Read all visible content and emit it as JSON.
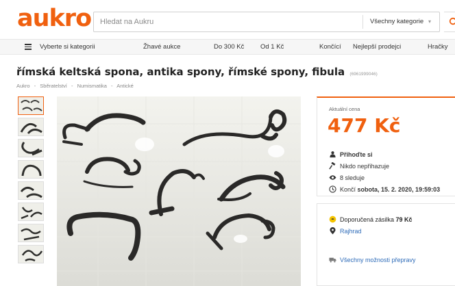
{
  "brand": {
    "logo": "aukro"
  },
  "search": {
    "placeholder": "Hledat na Aukru",
    "category": "Všechny kategorie"
  },
  "nav": {
    "all_categories": "Vyberte si kategorii",
    "items": [
      "Žhavé aukce",
      "Do 300 Kč",
      "Od 1 Kč",
      "Končící",
      "Nejlepší prodejci",
      "Hračky"
    ]
  },
  "listing": {
    "title": "římská keltská spona, antika spony, římské spony, fibula",
    "id": "(6961999046)",
    "breadcrumb": [
      "Aukro",
      "-",
      "Sběratelství",
      "-",
      "Numismatika",
      "-",
      "Antické"
    ]
  },
  "price_box": {
    "label": "Aktuální cena",
    "price": "477 Kč",
    "bid_link": "Přihoďte si",
    "bidders": "Nikdo nepřihazuje",
    "watchers": "8 sleduje",
    "ends_prefix": "Končí ",
    "ends_value": "sobota, 15. 2. 2020, 19:59:03"
  },
  "shipping": {
    "recommended_prefix": "Doporučená zásilka ",
    "recommended_price": "79 Kč",
    "location": "Rajhrad",
    "all_options": "Všechny možnosti přepravy"
  },
  "colors": {
    "accent": "#f0600f",
    "link": "#2d6bb8",
    "nav_bg": "#f6f6f6"
  },
  "icons": [
    "search-icon",
    "menu-icon",
    "user-icon",
    "gavel-icon",
    "eye-icon",
    "clock-icon",
    "medal-icon",
    "location-pin-icon",
    "truck-icon",
    "chevron-down-icon"
  ]
}
